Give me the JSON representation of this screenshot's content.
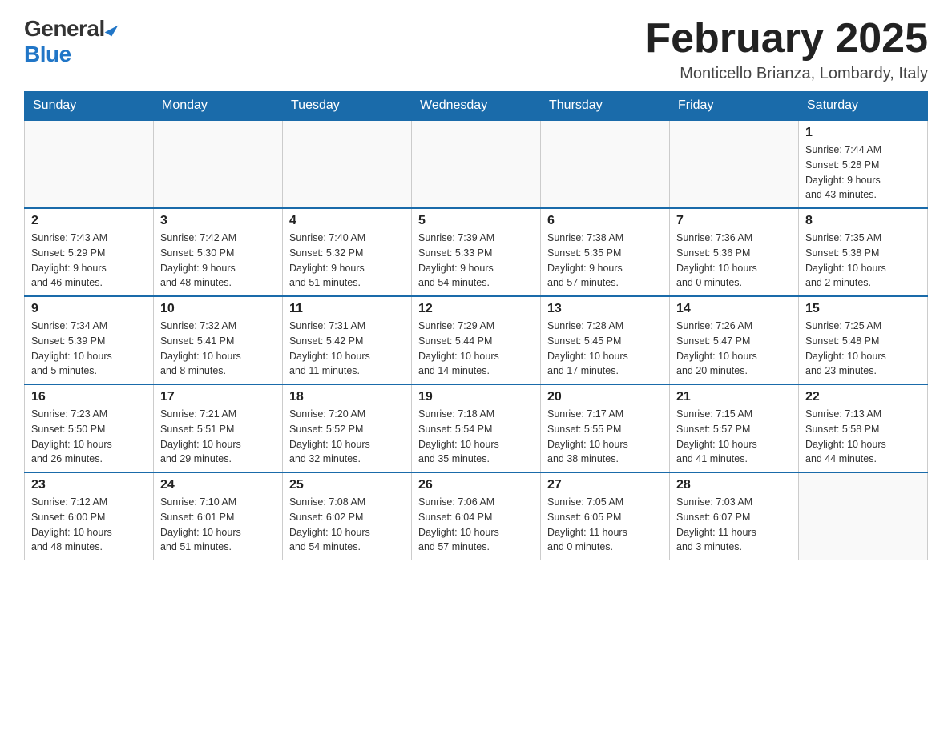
{
  "header": {
    "logo": {
      "general": "General",
      "blue": "Blue"
    },
    "title": "February 2025",
    "location": "Monticello Brianza, Lombardy, Italy"
  },
  "calendar": {
    "days_of_week": [
      "Sunday",
      "Monday",
      "Tuesday",
      "Wednesday",
      "Thursday",
      "Friday",
      "Saturday"
    ],
    "weeks": [
      [
        {
          "day": "",
          "info": ""
        },
        {
          "day": "",
          "info": ""
        },
        {
          "day": "",
          "info": ""
        },
        {
          "day": "",
          "info": ""
        },
        {
          "day": "",
          "info": ""
        },
        {
          "day": "",
          "info": ""
        },
        {
          "day": "1",
          "info": "Sunrise: 7:44 AM\nSunset: 5:28 PM\nDaylight: 9 hours\nand 43 minutes."
        }
      ],
      [
        {
          "day": "2",
          "info": "Sunrise: 7:43 AM\nSunset: 5:29 PM\nDaylight: 9 hours\nand 46 minutes."
        },
        {
          "day": "3",
          "info": "Sunrise: 7:42 AM\nSunset: 5:30 PM\nDaylight: 9 hours\nand 48 minutes."
        },
        {
          "day": "4",
          "info": "Sunrise: 7:40 AM\nSunset: 5:32 PM\nDaylight: 9 hours\nand 51 minutes."
        },
        {
          "day": "5",
          "info": "Sunrise: 7:39 AM\nSunset: 5:33 PM\nDaylight: 9 hours\nand 54 minutes."
        },
        {
          "day": "6",
          "info": "Sunrise: 7:38 AM\nSunset: 5:35 PM\nDaylight: 9 hours\nand 57 minutes."
        },
        {
          "day": "7",
          "info": "Sunrise: 7:36 AM\nSunset: 5:36 PM\nDaylight: 10 hours\nand 0 minutes."
        },
        {
          "day": "8",
          "info": "Sunrise: 7:35 AM\nSunset: 5:38 PM\nDaylight: 10 hours\nand 2 minutes."
        }
      ],
      [
        {
          "day": "9",
          "info": "Sunrise: 7:34 AM\nSunset: 5:39 PM\nDaylight: 10 hours\nand 5 minutes."
        },
        {
          "day": "10",
          "info": "Sunrise: 7:32 AM\nSunset: 5:41 PM\nDaylight: 10 hours\nand 8 minutes."
        },
        {
          "day": "11",
          "info": "Sunrise: 7:31 AM\nSunset: 5:42 PM\nDaylight: 10 hours\nand 11 minutes."
        },
        {
          "day": "12",
          "info": "Sunrise: 7:29 AM\nSunset: 5:44 PM\nDaylight: 10 hours\nand 14 minutes."
        },
        {
          "day": "13",
          "info": "Sunrise: 7:28 AM\nSunset: 5:45 PM\nDaylight: 10 hours\nand 17 minutes."
        },
        {
          "day": "14",
          "info": "Sunrise: 7:26 AM\nSunset: 5:47 PM\nDaylight: 10 hours\nand 20 minutes."
        },
        {
          "day": "15",
          "info": "Sunrise: 7:25 AM\nSunset: 5:48 PM\nDaylight: 10 hours\nand 23 minutes."
        }
      ],
      [
        {
          "day": "16",
          "info": "Sunrise: 7:23 AM\nSunset: 5:50 PM\nDaylight: 10 hours\nand 26 minutes."
        },
        {
          "day": "17",
          "info": "Sunrise: 7:21 AM\nSunset: 5:51 PM\nDaylight: 10 hours\nand 29 minutes."
        },
        {
          "day": "18",
          "info": "Sunrise: 7:20 AM\nSunset: 5:52 PM\nDaylight: 10 hours\nand 32 minutes."
        },
        {
          "day": "19",
          "info": "Sunrise: 7:18 AM\nSunset: 5:54 PM\nDaylight: 10 hours\nand 35 minutes."
        },
        {
          "day": "20",
          "info": "Sunrise: 7:17 AM\nSunset: 5:55 PM\nDaylight: 10 hours\nand 38 minutes."
        },
        {
          "day": "21",
          "info": "Sunrise: 7:15 AM\nSunset: 5:57 PM\nDaylight: 10 hours\nand 41 minutes."
        },
        {
          "day": "22",
          "info": "Sunrise: 7:13 AM\nSunset: 5:58 PM\nDaylight: 10 hours\nand 44 minutes."
        }
      ],
      [
        {
          "day": "23",
          "info": "Sunrise: 7:12 AM\nSunset: 6:00 PM\nDaylight: 10 hours\nand 48 minutes."
        },
        {
          "day": "24",
          "info": "Sunrise: 7:10 AM\nSunset: 6:01 PM\nDaylight: 10 hours\nand 51 minutes."
        },
        {
          "day": "25",
          "info": "Sunrise: 7:08 AM\nSunset: 6:02 PM\nDaylight: 10 hours\nand 54 minutes."
        },
        {
          "day": "26",
          "info": "Sunrise: 7:06 AM\nSunset: 6:04 PM\nDaylight: 10 hours\nand 57 minutes."
        },
        {
          "day": "27",
          "info": "Sunrise: 7:05 AM\nSunset: 6:05 PM\nDaylight: 11 hours\nand 0 minutes."
        },
        {
          "day": "28",
          "info": "Sunrise: 7:03 AM\nSunset: 6:07 PM\nDaylight: 11 hours\nand 3 minutes."
        },
        {
          "day": "",
          "info": ""
        }
      ]
    ]
  }
}
